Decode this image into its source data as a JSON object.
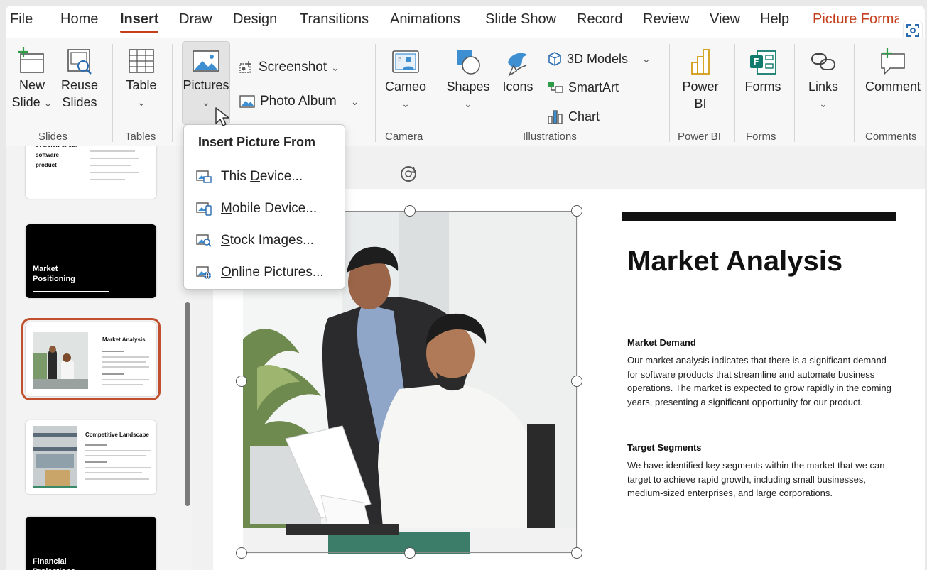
{
  "menu": {
    "tabs": [
      "File",
      "Home",
      "Insert",
      "Draw",
      "Design",
      "Transitions",
      "Animations",
      "Slide Show",
      "Record",
      "Review",
      "View",
      "Help"
    ],
    "context_tab": "Picture Format",
    "active": "Insert"
  },
  "ribbon": {
    "new_slide": [
      "New",
      "Slide"
    ],
    "reuse_slides": [
      "Reuse",
      "Slides"
    ],
    "table": "Table",
    "pictures": "Pictures",
    "screenshot": "Screenshot",
    "photo_album": "Photo Album",
    "cameo": "Cameo",
    "shapes": "Shapes",
    "icons": "Icons",
    "models_3d": "3D Models",
    "smartart": "SmartArt",
    "chart": "Chart",
    "power_bi": [
      "Power",
      "BI"
    ],
    "forms": "Forms",
    "links": "Links",
    "comment": "Comment",
    "groups": {
      "slides": "Slides",
      "tables": "Tables",
      "camera": "Camera",
      "illustrations": "Illustrations",
      "power_bi": "Power BI",
      "forms": "Forms",
      "comments": "Comments"
    }
  },
  "dropdown": {
    "header": "Insert Picture From",
    "items": [
      {
        "pre": "This ",
        "key": "D",
        "post": "evice..."
      },
      {
        "pre": "",
        "key": "M",
        "post": "obile Device..."
      },
      {
        "pre": "",
        "key": "S",
        "post": "tock Images..."
      },
      {
        "pre": "",
        "key": "O",
        "post": "nline Pictures..."
      }
    ]
  },
  "thumbnails": {
    "t1_text": "overview of our software product",
    "t2_title": "Market Positioning",
    "t3_title": "Market Analysis",
    "t4_title": "Competitive Landscape",
    "t5_title": "Financial Projections"
  },
  "slide": {
    "title": "Market Analysis",
    "section1_heading": "Market Demand",
    "section1_body": "Our market analysis indicates that there is a significant demand for software products that streamline and automate business operations. The market is expected to grow rapidly in the coming years, presenting a significant opportunity for our product.",
    "section2_heading": "Target Segments",
    "section2_body": "We have identified key segments within the market that we can target to achieve rapid growth, including small businesses, medium-sized enterprises, and large corporations."
  },
  "colors": {
    "accent": "#c43e1c",
    "selected_outline": "#c0502d",
    "slide_bar": "#111111"
  }
}
